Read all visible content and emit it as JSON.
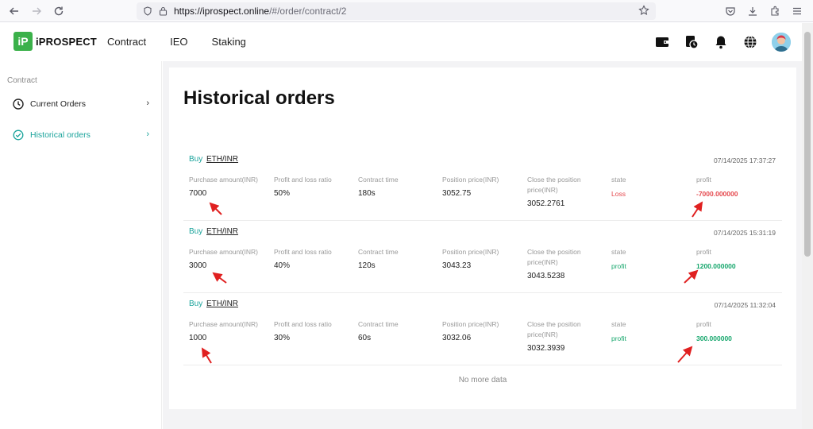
{
  "browser": {
    "url_host": "https://iprospect.online",
    "url_rest": "/#/order/contract/2"
  },
  "app": {
    "logo_mark": "iP",
    "logo_text": "iPROSPECT",
    "nav": [
      "Contract",
      "IEO",
      "Staking"
    ]
  },
  "sidebar": {
    "title": "Contract",
    "items": [
      {
        "label": "Current Orders",
        "chevron": "›"
      },
      {
        "label": "Historical orders",
        "chevron": "›"
      }
    ]
  },
  "page": {
    "title": "Historical orders",
    "no_more": "No more data"
  },
  "labels": {
    "purchase": "Purchase amount(INR)",
    "ratio": "Profit and loss ratio",
    "time": "Contract time",
    "position": "Position price(INR)",
    "close": "Close the position price(INR)",
    "state": "state",
    "profit": "profit"
  },
  "colors": {
    "accent": "#1aa39b",
    "loss": "#e5484d",
    "gain": "#14a66b",
    "annotation": "#e02020"
  },
  "orders": [
    {
      "direction": "Buy",
      "pair": "ETH/INR",
      "timestamp": "07/14/2025 17:37:27",
      "purchase": "7000",
      "ratio": "50%",
      "time": "180s",
      "position": "3052.75",
      "close": "3052.2761",
      "state": "Loss",
      "profit": "-7000.000000",
      "state_type": "loss"
    },
    {
      "direction": "Buy",
      "pair": "ETH/INR",
      "timestamp": "07/14/2025 15:31:19",
      "purchase": "3000",
      "ratio": "40%",
      "time": "120s",
      "position": "3043.23",
      "close": "3043.5238",
      "state": "profit",
      "profit": "1200.000000",
      "state_type": "gain"
    },
    {
      "direction": "Buy",
      "pair": "ETH/INR",
      "timestamp": "07/14/2025 11:32:04",
      "purchase": "1000",
      "ratio": "30%",
      "time": "60s",
      "position": "3032.06",
      "close": "3032.3939",
      "state": "profit",
      "profit": "300.000000",
      "state_type": "gain"
    }
  ]
}
